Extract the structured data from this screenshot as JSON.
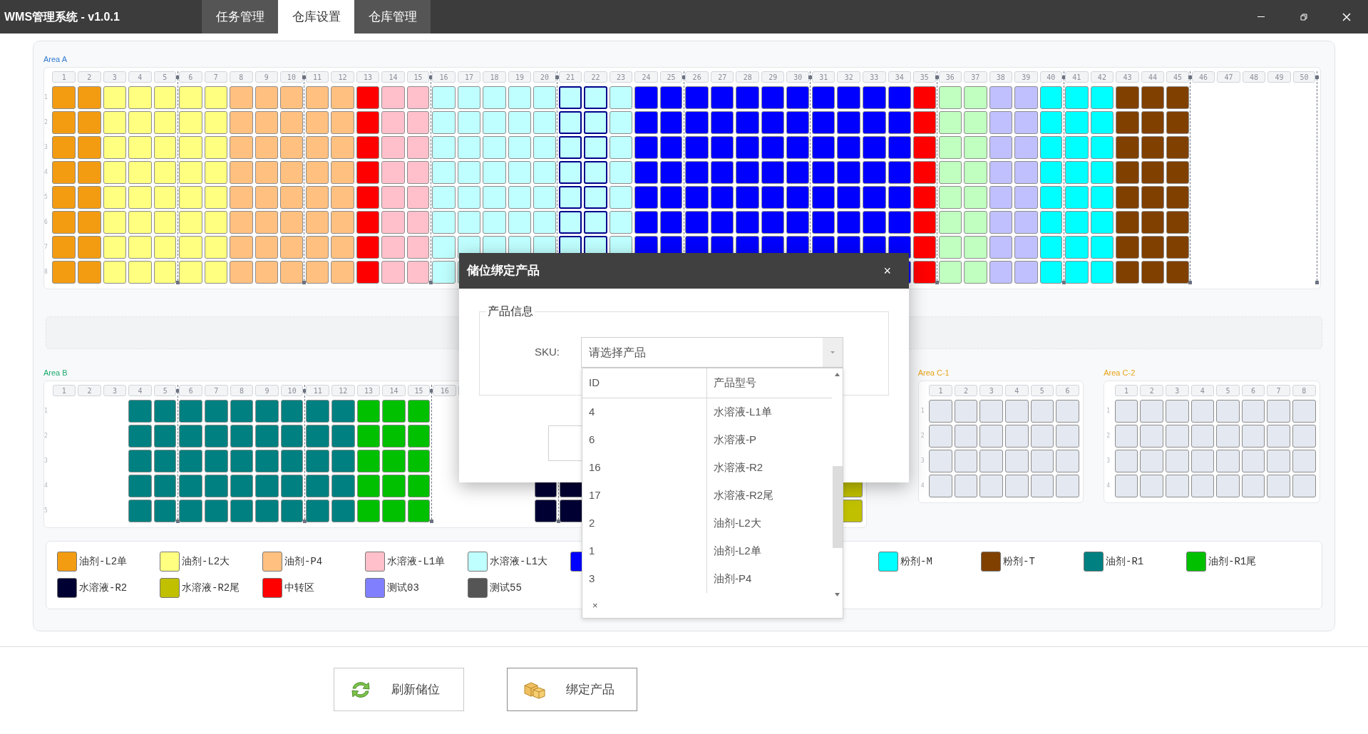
{
  "app": {
    "title": "WMS管理系统 - v1.0.1",
    "tabs": [
      {
        "label": "任务管理",
        "selected": false
      },
      {
        "label": "仓库设置",
        "selected": true
      },
      {
        "label": "仓库管理",
        "selected": false
      }
    ]
  },
  "main_area": {
    "title": "Area A",
    "color": "#2f7bd0",
    "grouped": true,
    "rows": [
      "1",
      "2",
      "3",
      "4",
      "5",
      "6",
      "7",
      "8"
    ],
    "columns": [
      {
        "label": "1",
        "color": "#f39c12",
        "selected": false
      },
      {
        "label": "2",
        "color": "#f39c12",
        "selected": false
      },
      {
        "label": "3",
        "color": "#ffff80",
        "selected": false
      },
      {
        "label": "4",
        "color": "#ffff80",
        "selected": false
      },
      {
        "label": "5",
        "color": "#ffff80",
        "selected": false
      },
      {
        "label": "6",
        "color": "#ffff80",
        "selected": false
      },
      {
        "label": "7",
        "color": "#ffff80",
        "selected": false
      },
      {
        "label": "8",
        "color": "#ffc080",
        "selected": false
      },
      {
        "label": "9",
        "color": "#ffc080",
        "selected": false
      },
      {
        "label": "10",
        "color": "#ffc080",
        "selected": false
      },
      {
        "label": "11",
        "color": "#ffc080",
        "selected": false
      },
      {
        "label": "12",
        "color": "#ffc080",
        "selected": false
      },
      {
        "label": "13",
        "color": "#ff0000",
        "selected": false
      },
      {
        "label": "14",
        "color": "#ffc0cb",
        "selected": false
      },
      {
        "label": "15",
        "color": "#ffc0cb",
        "selected": false
      },
      {
        "label": "16",
        "color": "#c0ffff",
        "selected": false
      },
      {
        "label": "17",
        "color": "#c0ffff",
        "selected": false
      },
      {
        "label": "18",
        "color": "#c0ffff",
        "selected": false
      },
      {
        "label": "19",
        "color": "#c0ffff",
        "selected": false
      },
      {
        "label": "20",
        "color": "#c0ffff",
        "selected": false
      },
      {
        "label": "21",
        "color": "#c0ffff",
        "selected": true
      },
      {
        "label": "22",
        "color": "#c0ffff",
        "selected": true
      },
      {
        "label": "23",
        "color": "#c0ffff",
        "selected": false
      },
      {
        "label": "24",
        "color": "#0000ff",
        "selected": false
      },
      {
        "label": "25",
        "color": "#0000ff",
        "selected": false
      },
      {
        "label": "26",
        "color": "#0000ff",
        "selected": false
      },
      {
        "label": "27",
        "color": "#0000ff",
        "selected": false
      },
      {
        "label": "28",
        "color": "#0000ff",
        "selected": false
      },
      {
        "label": "29",
        "color": "#0000ff",
        "selected": false
      },
      {
        "label": "30",
        "color": "#0000ff",
        "selected": false
      },
      {
        "label": "31",
        "color": "#0000ff",
        "selected": false
      },
      {
        "label": "32",
        "color": "#0000ff",
        "selected": false
      },
      {
        "label": "33",
        "color": "#0000ff",
        "selected": false
      },
      {
        "label": "34",
        "color": "#0000ff",
        "selected": false
      },
      {
        "label": "35",
        "color": "#ff0000",
        "selected": false
      },
      {
        "label": "36",
        "color": "#c0ffc0",
        "selected": false
      },
      {
        "label": "37",
        "color": "#c0ffc0",
        "selected": false
      },
      {
        "label": "38",
        "color": "#c0c0ff",
        "selected": false
      },
      {
        "label": "39",
        "color": "#c0c0ff",
        "selected": false
      },
      {
        "label": "40",
        "color": "#00ffff",
        "selected": false
      },
      {
        "label": "41",
        "color": "#00ffff",
        "selected": false
      },
      {
        "label": "42",
        "color": "#00ffff",
        "selected": false
      },
      {
        "label": "43",
        "color": "#804000",
        "selected": false
      },
      {
        "label": "44",
        "color": "#804000",
        "selected": false
      },
      {
        "label": "45",
        "color": "#804000",
        "selected": false
      },
      {
        "label": "46"
      },
      {
        "label": "47"
      },
      {
        "label": "48"
      },
      {
        "label": "49"
      },
      {
        "label": "50"
      }
    ]
  },
  "side_areas": [
    {
      "title": "Area B",
      "color": "#1aab6d",
      "grouped": true,
      "rows": [
        "1",
        "2",
        "3",
        "4",
        "5"
      ],
      "columns": [
        {
          "label": "1"
        },
        {
          "label": "2"
        },
        {
          "label": "3"
        },
        {
          "label": "4",
          "color": "#008080",
          "selected": false
        },
        {
          "label": "5",
          "color": "#008080",
          "selected": false
        },
        {
          "label": "6",
          "color": "#008080",
          "selected": false
        },
        {
          "label": "7",
          "color": "#008080",
          "selected": false
        },
        {
          "label": "8",
          "color": "#008080",
          "selected": false
        },
        {
          "label": "9",
          "color": "#008080",
          "selected": false
        },
        {
          "label": "10",
          "color": "#008080",
          "selected": false
        },
        {
          "label": "11",
          "color": "#008080",
          "selected": false
        },
        {
          "label": "12",
          "color": "#008080",
          "selected": false
        },
        {
          "label": "13",
          "color": "#00c000",
          "selected": false
        },
        {
          "label": "14",
          "color": "#00c000",
          "selected": false
        },
        {
          "label": "15",
          "color": "#00c000",
          "selected": false
        },
        {
          "label": "16"
        },
        {},
        {},
        {},
        {
          "color": "#000033",
          "selected": false
        },
        {
          "color": "#000033",
          "selected": false
        },
        {},
        {},
        {},
        {},
        {},
        {},
        {},
        {},
        {},
        {},
        {
          "color": "#c0c000",
          "selected": false
        }
      ]
    },
    {
      "title": "Area C-1",
      "color": "#e8a317",
      "grouped": false,
      "rows": [
        "1",
        "2",
        "3",
        "4"
      ],
      "columns": [
        {
          "label": "1",
          "color": "#e4e8f0",
          "selected": false
        },
        {
          "label": "2",
          "color": "#e4e8f0",
          "selected": false
        },
        {
          "label": "3",
          "color": "#e4e8f0",
          "selected": false
        },
        {
          "label": "4",
          "color": "#e4e8f0",
          "selected": false
        },
        {
          "label": "5",
          "color": "#e4e8f0",
          "selected": false
        },
        {
          "label": "6",
          "color": "#e4e8f0",
          "selected": false
        }
      ]
    },
    {
      "title": "Area C-2",
      "color": "#e8a317",
      "grouped": false,
      "rows": [
        "1",
        "2",
        "3",
        "4"
      ],
      "columns": [
        {
          "label": "1",
          "color": "#e4e8f0",
          "selected": false
        },
        {
          "label": "2",
          "color": "#e4e8f0",
          "selected": false
        },
        {
          "label": "3",
          "color": "#e4e8f0",
          "selected": false
        },
        {
          "label": "4",
          "color": "#e4e8f0",
          "selected": false
        },
        {
          "label": "5",
          "color": "#e4e8f0",
          "selected": false
        },
        {
          "label": "6",
          "color": "#e4e8f0",
          "selected": false
        },
        {
          "label": "7",
          "color": "#e4e8f0",
          "selected": false
        },
        {
          "label": "8",
          "color": "#e4e8f0",
          "selected": false
        }
      ]
    }
  ],
  "legend": [
    {
      "label": "油剂-L2单",
      "color": "#f39c12"
    },
    {
      "label": "油剂-L2大",
      "color": "#ffff80"
    },
    {
      "label": "油剂-P4",
      "color": "#ffc080"
    },
    {
      "label": "水溶液-L1单",
      "color": "#ffc0cb"
    },
    {
      "label": "水溶液-L1大",
      "color": "#c0ffff"
    },
    {
      "color": "#0000ff"
    },
    {
      "label": "粉剂-M",
      "color": "#00ffff"
    },
    {
      "label": "粉剂-T",
      "color": "#804000"
    },
    {
      "label": "油剂-R1",
      "color": "#008080"
    },
    {
      "label": "油剂-R1尾",
      "color": "#00c000"
    },
    {
      "label": "水溶液-R2",
      "color": "#000033"
    },
    {
      "label": "水溶液-R2尾",
      "color": "#c0c000"
    },
    {
      "label": "中转区",
      "color": "#ff0000"
    },
    {
      "label": "测试03",
      "color": "#8080ff"
    },
    {
      "label": "测试55",
      "color": "#555555"
    }
  ],
  "buttons": [
    {
      "label": "刷新储位",
      "kind": "refresh"
    },
    {
      "label": "绑定产品",
      "kind": "bind"
    }
  ],
  "dialog": {
    "title": "储位绑定产品",
    "close": "×",
    "section": "产品信息",
    "sku_label": "SKU:",
    "sku_placeholder": "请选择产品",
    "dropdown": {
      "columns": [
        "ID",
        "产品型号"
      ],
      "rows": [
        {
          "id": "4",
          "model": "水溶液-L1单"
        },
        {
          "id": "6",
          "model": "水溶液-P"
        },
        {
          "id": "16",
          "model": "水溶液-R2"
        },
        {
          "id": "17",
          "model": "水溶液-R2尾"
        },
        {
          "id": "2",
          "model": "油剂-L2大"
        },
        {
          "id": "1",
          "model": "油剂-L2单"
        },
        {
          "id": "3",
          "model": "油剂-P4"
        }
      ],
      "clear": "×"
    }
  }
}
